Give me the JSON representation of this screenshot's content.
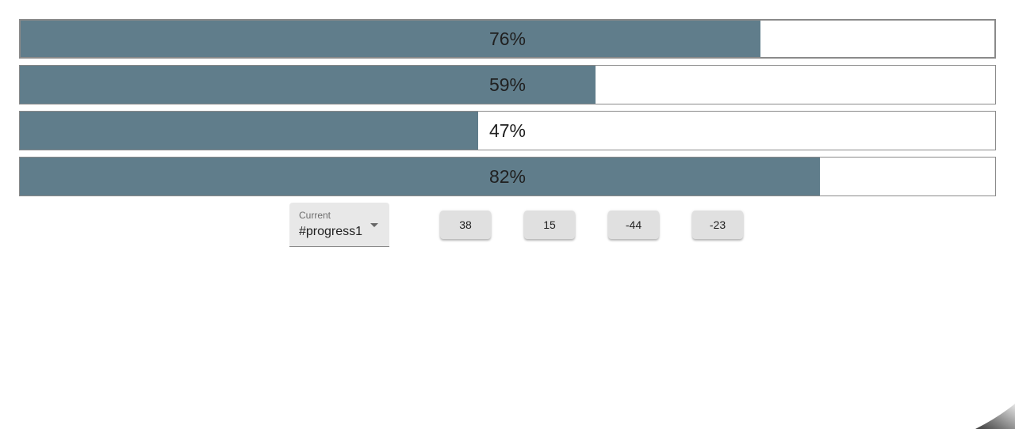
{
  "progress_bars": [
    {
      "id": "progress1",
      "value": 76,
      "label": "76%",
      "active": true
    },
    {
      "id": "progress2",
      "value": 59,
      "label": "59%",
      "active": false
    },
    {
      "id": "progress3",
      "value": 47,
      "label": "47%",
      "active": false
    },
    {
      "id": "progress4",
      "value": 82,
      "label": "82%",
      "active": false
    }
  ],
  "selector": {
    "caption": "Current",
    "selected": "#progress1",
    "arrow_icon": "chevron-down-icon"
  },
  "buttons": [
    {
      "label": "38"
    },
    {
      "label": "15"
    },
    {
      "label": "-44"
    },
    {
      "label": "-23"
    }
  ],
  "colors": {
    "fill": "#607d8b",
    "track": "#ffffff",
    "border": "#8a8a8a",
    "button_bg": "#e0e0e0",
    "select_bg": "#e8e8e8"
  }
}
